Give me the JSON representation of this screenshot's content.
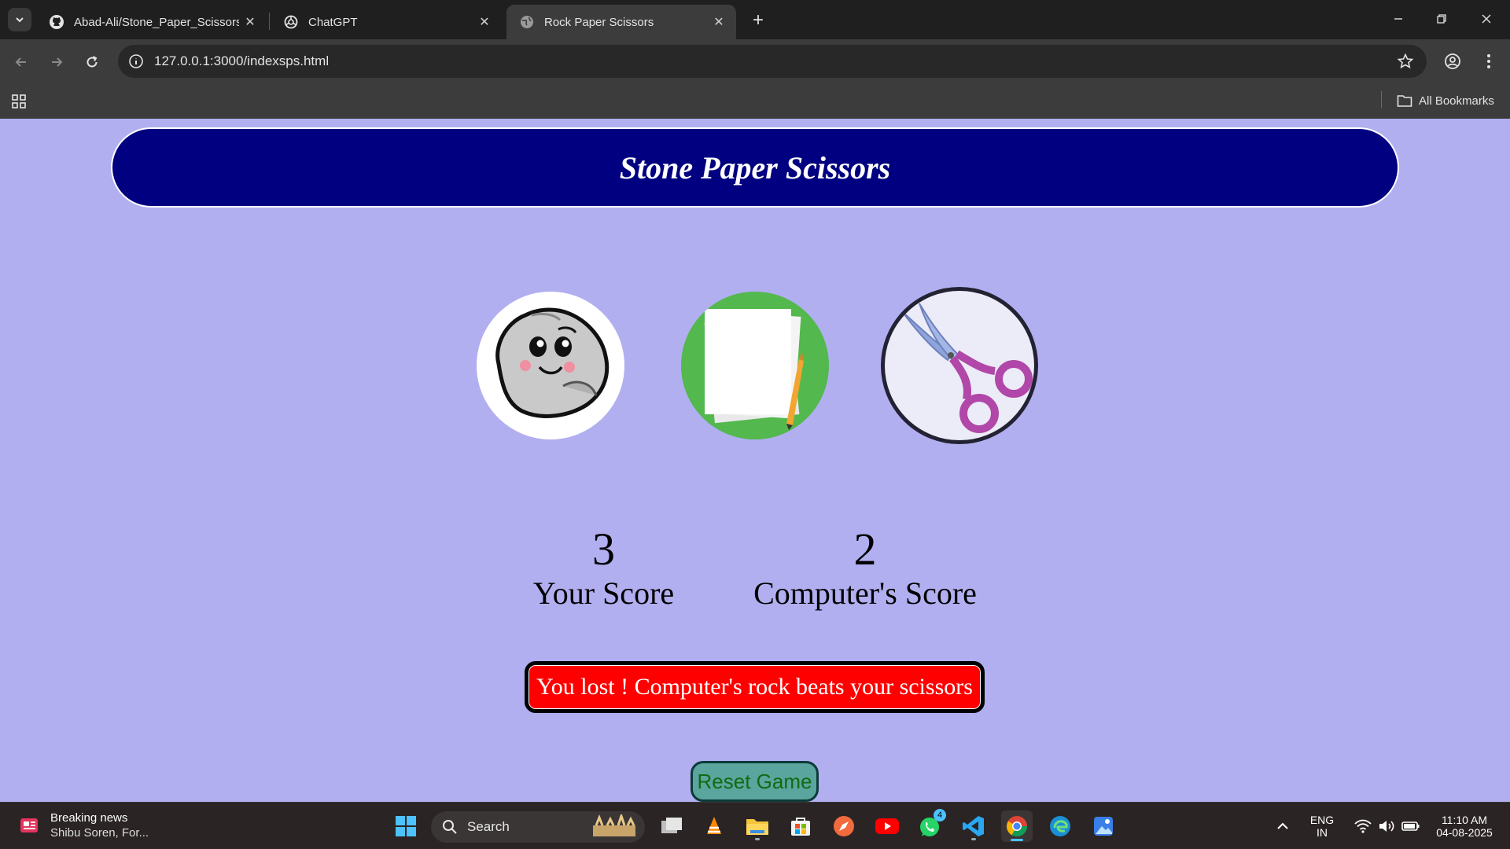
{
  "browser": {
    "tabs": [
      {
        "title": "Abad-Ali/Stone_Paper_Scissors:",
        "icon": "github-icon",
        "active": false
      },
      {
        "title": "ChatGPT",
        "icon": "chatgpt-icon",
        "active": false
      },
      {
        "title": "Rock Paper Scissors",
        "icon": "globe-icon",
        "active": true
      }
    ],
    "url": "127.0.0.1:3000/indexsps.html",
    "all_bookmarks": "All Bookmarks"
  },
  "page": {
    "title": "Stone Paper Scissors",
    "choices": [
      {
        "name": "rock",
        "icon": "rock-icon"
      },
      {
        "name": "paper",
        "icon": "paper-icon"
      },
      {
        "name": "scissors",
        "icon": "scissors-icon"
      }
    ],
    "user_score": "3",
    "user_score_label": "Your Score",
    "computer_score": "2",
    "computer_score_label": "Computer's Score",
    "message": "You lost ! Computer's rock beats your scissors",
    "reset_label": "Reset Game",
    "colors": {
      "background": "#b1aff0",
      "banner": "#000080",
      "message_bg": "#ff0000",
      "reset_bg": "#5aa59d",
      "reset_text": "#116b11"
    }
  },
  "taskbar": {
    "news_title": "Breaking news",
    "news_sub": "Shibu Soren, For...",
    "search_label": "Search",
    "whatsapp_badge": "4",
    "lang_top": "ENG",
    "lang_bottom": "IN",
    "time": "11:10 AM",
    "date": "04-08-2025"
  }
}
